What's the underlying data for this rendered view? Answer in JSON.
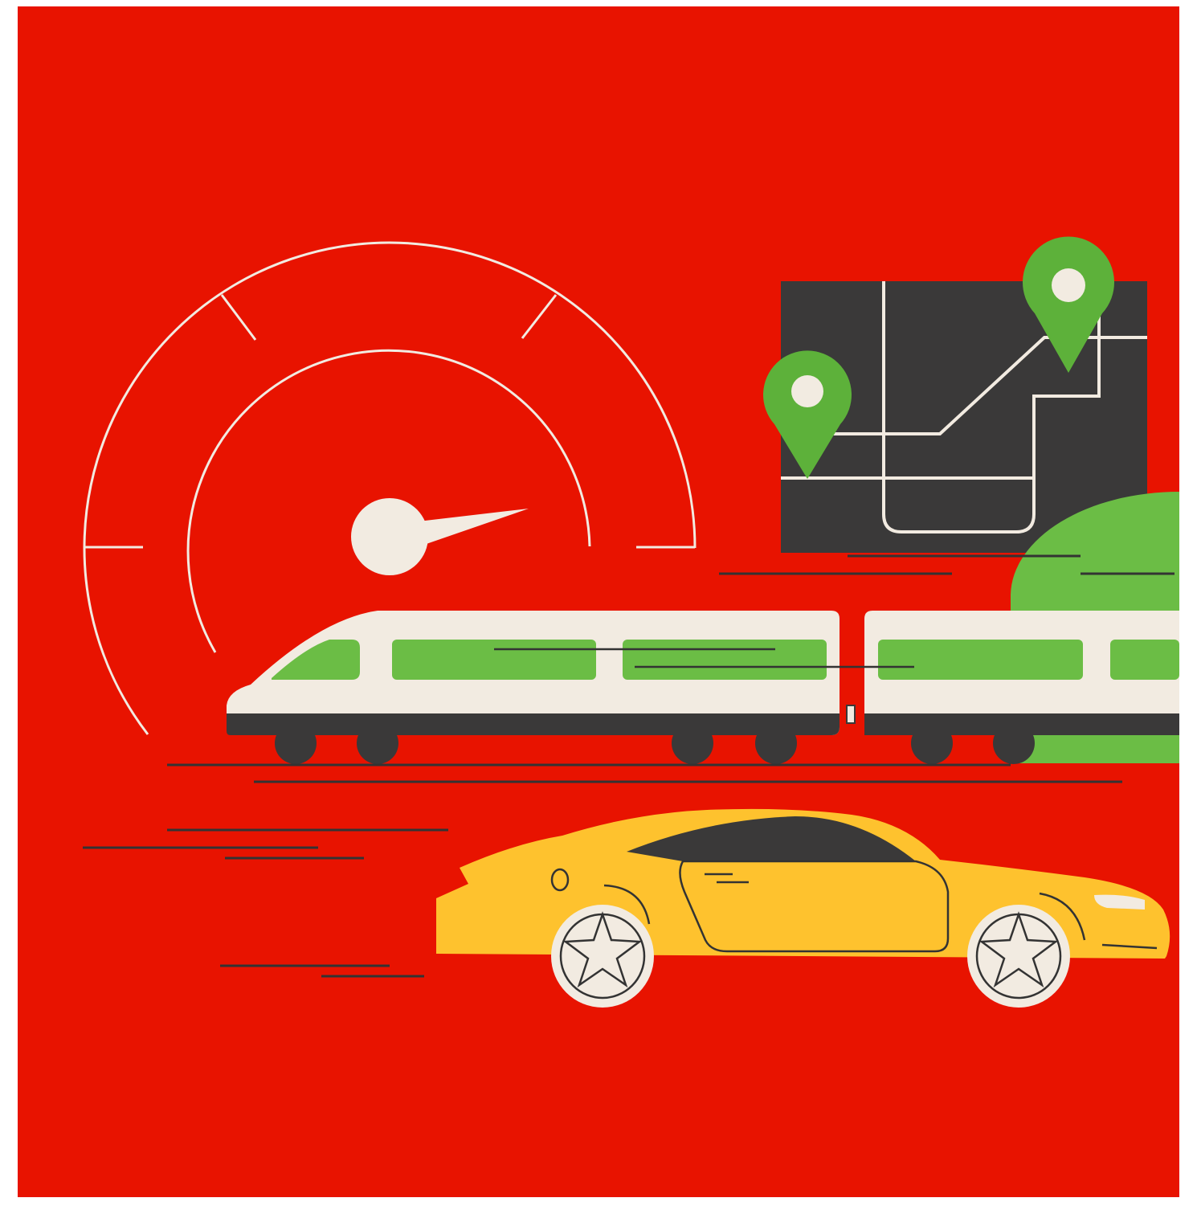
{
  "scene": {
    "background_color": "#E81300",
    "frame_color": "#FFFFFF",
    "subjects": [
      "speedometer-icon",
      "map-icon",
      "location-pin-icon",
      "high-speed-train",
      "sports-car",
      "bush"
    ],
    "colors": {
      "red": "#E81300",
      "cream": "#F2EBE1",
      "dark": "#3A3939",
      "green": "#6BBD45",
      "pin_green": "#5DB13A",
      "yellow": "#FEC22E",
      "line": "#333333"
    }
  }
}
